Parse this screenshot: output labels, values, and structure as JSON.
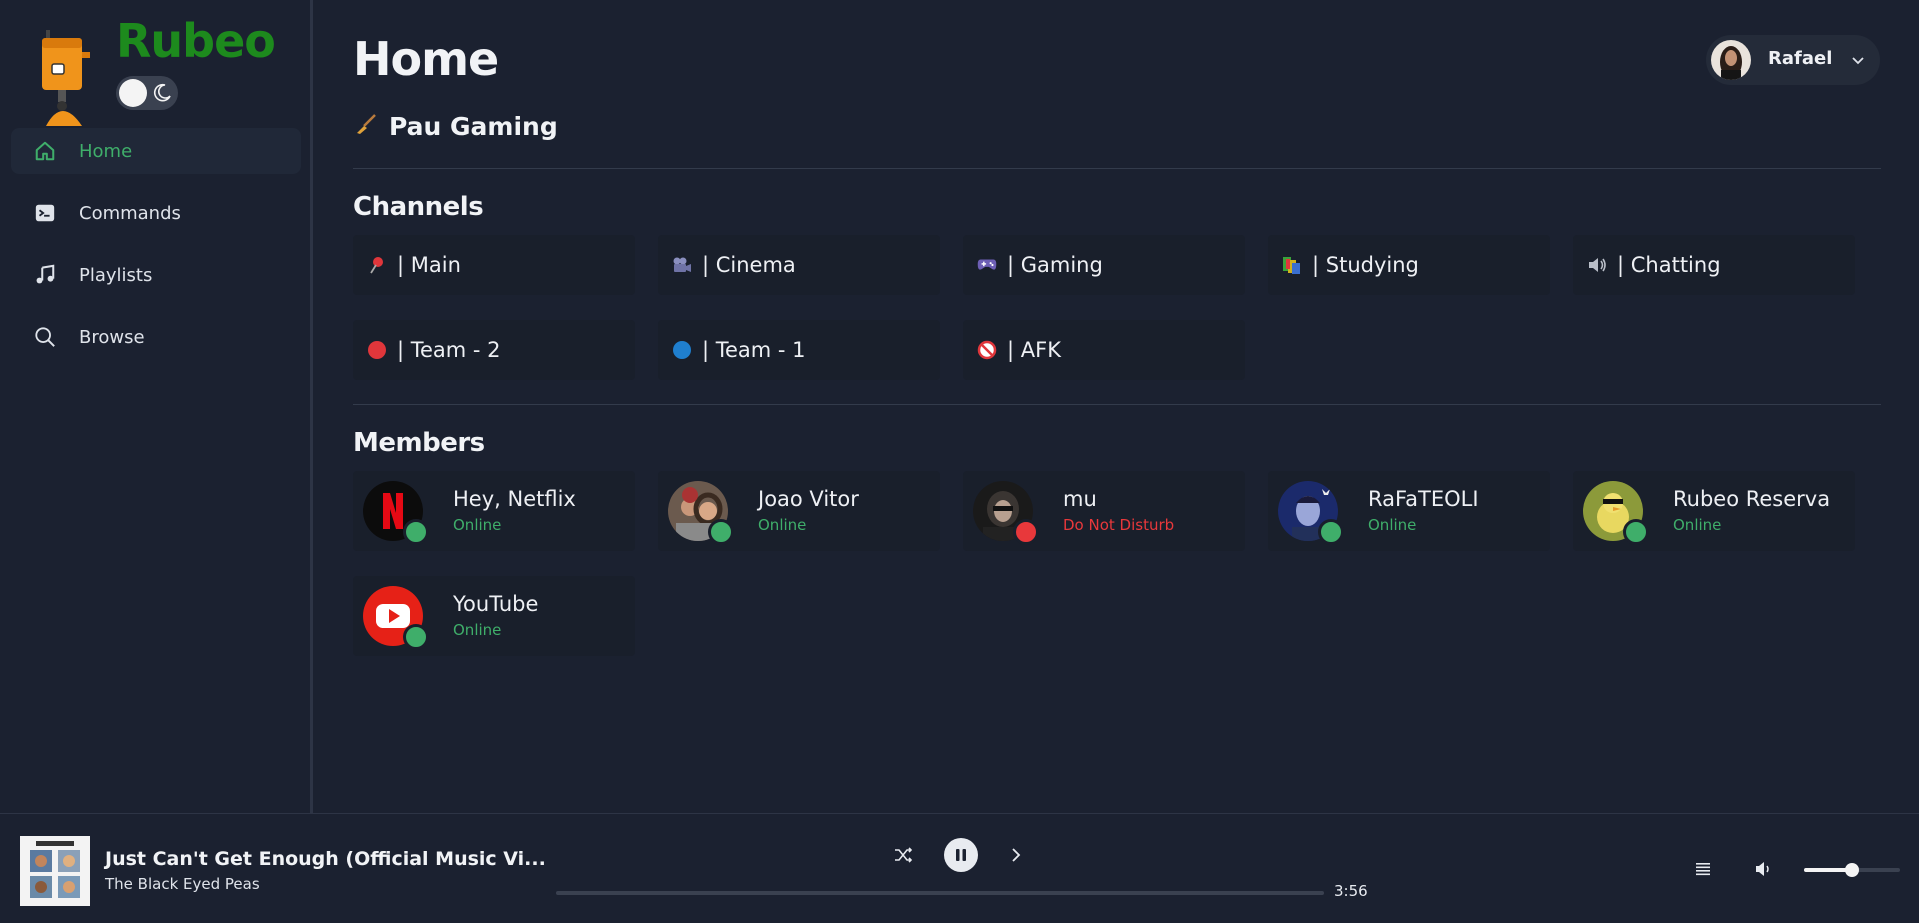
{
  "brand": {
    "name": "Rubeo"
  },
  "sidebar": {
    "items": [
      {
        "label": "Home",
        "icon": "home-icon",
        "active": true
      },
      {
        "label": "Commands",
        "icon": "terminal-icon",
        "active": false
      },
      {
        "label": "Playlists",
        "icon": "music-note-icon",
        "active": false
      },
      {
        "label": "Browse",
        "icon": "search-icon",
        "active": false
      }
    ]
  },
  "header": {
    "title": "Home",
    "server": "Pau Gaming",
    "user": "Rafael"
  },
  "channels": {
    "title": "Channels",
    "items": [
      {
        "label": "| Main",
        "icon": "pushpin-icon"
      },
      {
        "label": "| Cinema",
        "icon": "movie-camera-icon"
      },
      {
        "label": "| Gaming",
        "icon": "gamepad-icon"
      },
      {
        "label": "| Studying",
        "icon": "books-icon"
      },
      {
        "label": "| Chatting",
        "icon": "speaker-icon"
      },
      {
        "label": "| Team - 2",
        "icon": "red-circle-icon"
      },
      {
        "label": "| Team - 1",
        "icon": "blue-circle-icon"
      },
      {
        "label": "| AFK",
        "icon": "no-entry-icon"
      }
    ]
  },
  "members": {
    "title": "Members",
    "items": [
      {
        "name": "Hey, Netflix",
        "status": "Online"
      },
      {
        "name": "Joao Vitor",
        "status": "Online"
      },
      {
        "name": "mu",
        "status": "Do Not Disturb"
      },
      {
        "name": "RaFaTEOLI",
        "status": "Online"
      },
      {
        "name": "Rubeo Reserva",
        "status": "Online"
      },
      {
        "name": "YouTube",
        "status": "Online"
      }
    ]
  },
  "player": {
    "title": "Just Can't Get Enough (Official Music Vi...",
    "artist": "The Black Eyed Peas",
    "duration": "3:56",
    "progress": 0.0,
    "volume": 0.5
  },
  "colors": {
    "online": "#3fae6a",
    "dnd": "#e8383b",
    "brand": "#1d8a1d",
    "active_nav": "#3fae6a"
  }
}
